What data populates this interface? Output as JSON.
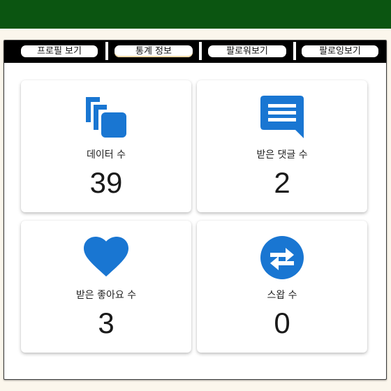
{
  "tabs": [
    {
      "label": "프로필 보기",
      "active": false
    },
    {
      "label": "통계 정보",
      "active": true
    },
    {
      "label": "팔로워보기",
      "active": false
    },
    {
      "label": "팔로잉보기",
      "active": false
    }
  ],
  "stats": [
    {
      "label": "데이터 수",
      "value": "39",
      "icon": "copy-icon"
    },
    {
      "label": "받은 댓글 수",
      "value": "2",
      "icon": "comment-icon"
    },
    {
      "label": "받은 좋아요 수",
      "value": "3",
      "icon": "heart-icon"
    },
    {
      "label": "스왑 수",
      "value": "0",
      "icon": "swap-icon"
    }
  ],
  "colors": {
    "header": "#0b5511",
    "background": "#fbf6ec",
    "accent": "#1976d2",
    "tabbar": "#000000"
  }
}
